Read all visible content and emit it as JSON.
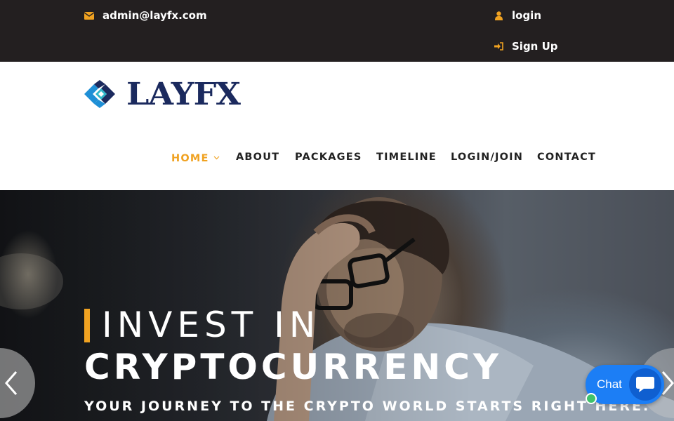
{
  "topbar": {
    "email": "admin@layfx.com",
    "login": "login",
    "signup": "Sign Up"
  },
  "brand": {
    "name": "LAYFX"
  },
  "nav": {
    "items": [
      "HOME",
      "ABOUT",
      "PACKAGES",
      "TIMELINE",
      "LOGIN/JOIN",
      "CONTACT"
    ],
    "active": "HOME"
  },
  "hero": {
    "line1": "INVEST IN",
    "line2": "CRYPTOCURRENCY",
    "line3": "YOUR JOURNEY TO THE CRYPTO WORLD STARTS RIGHT HERE."
  },
  "chat": {
    "label": "Chat"
  },
  "colors": {
    "topbar_bg": "#231f20",
    "accent": "#f0a221",
    "brand_navy": "#1b2a5e",
    "chat_blue": "#1c7ef5",
    "online_green": "#3fc26b"
  },
  "icons": {
    "email": "envelope-icon",
    "login": "user-icon",
    "signup": "sign-in-icon",
    "home_dropdown": "chevron-down-icon",
    "slider_prev": "chevron-left-icon",
    "slider_next": "chevron-right-icon",
    "chat": "chat-bubble-icon"
  }
}
